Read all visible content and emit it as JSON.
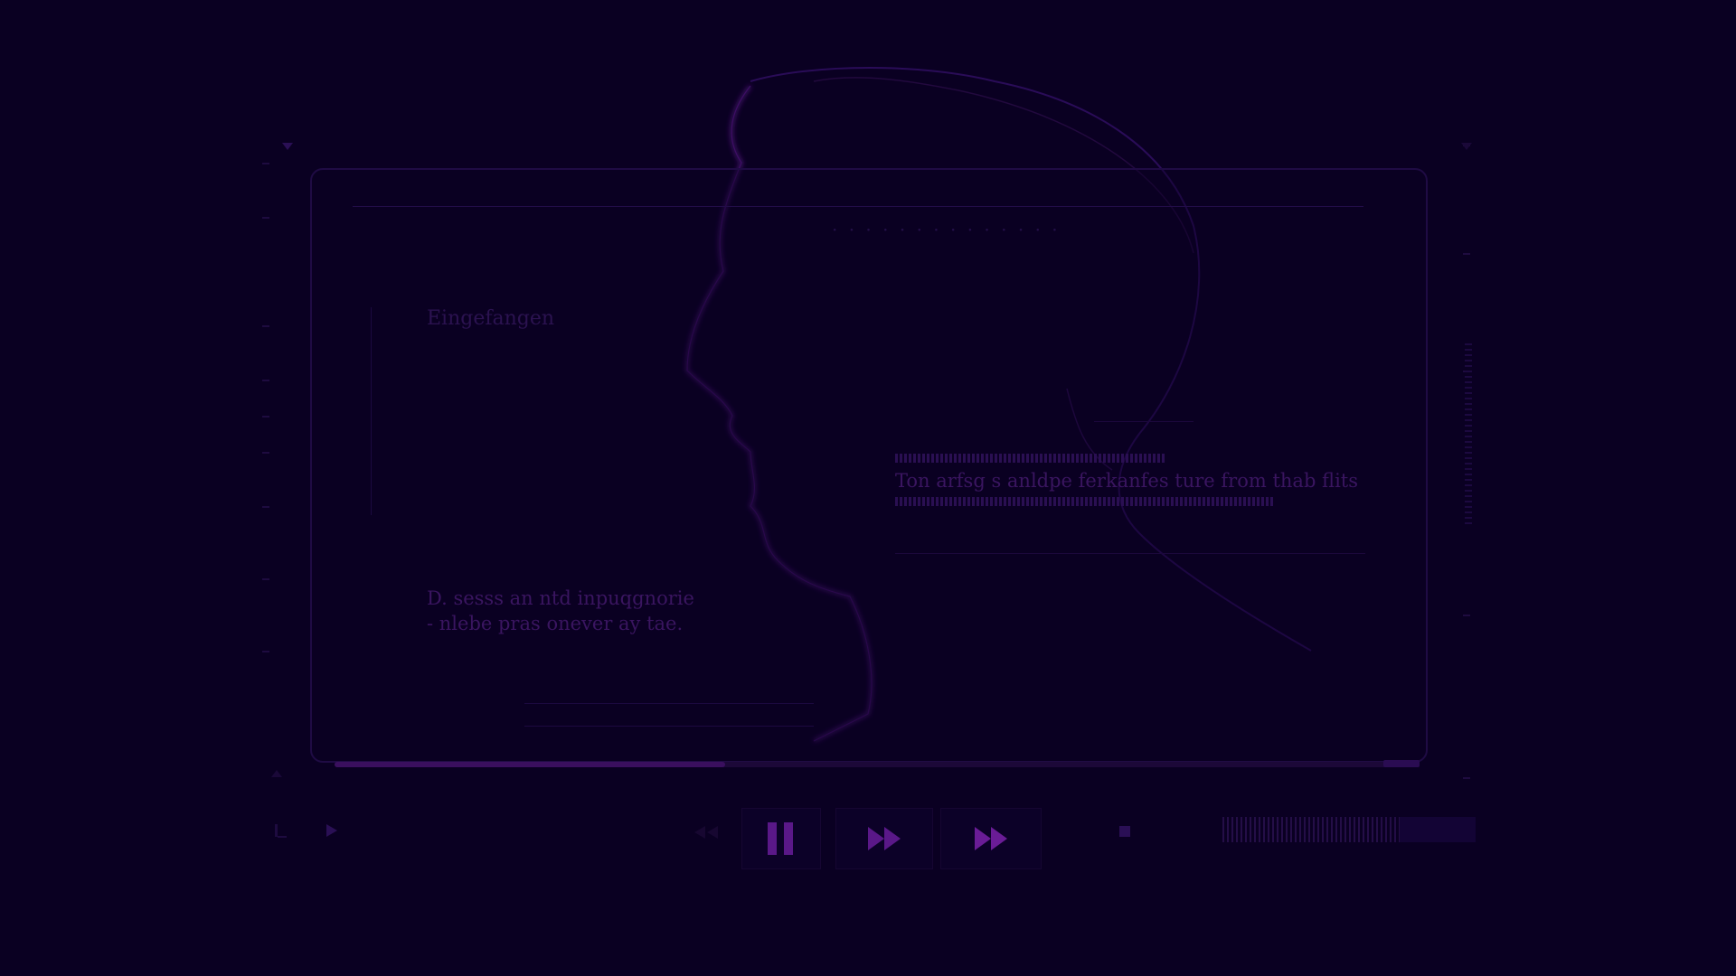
{
  "video": {
    "title": "· · · · · · · · · · · · · ·",
    "label_top": "Eingefangen",
    "caption_main": "Ton arfsg s anldpe ferkanfes ture from thab flits",
    "subtitle_line1": "D. sesss an ntd inpuqgnorie",
    "subtitle_line2": "- nlebe pras onever ay tae."
  },
  "playback": {
    "progress": 0.36
  },
  "volume": {
    "level": 0.7
  },
  "controls": {
    "prev_icon": "prev-icon",
    "play_small_icon": "play-icon",
    "rewind_icon": "rewind-icon",
    "pause_icon": "pause-icon",
    "fast_forward_icon": "fast-forward-icon",
    "skip_forward_icon": "skip-forward-icon",
    "stop_icon": "stop-icon"
  },
  "colors": {
    "background": "#0a0022",
    "accent": "#7a1ca8",
    "text": "#3a1560"
  }
}
